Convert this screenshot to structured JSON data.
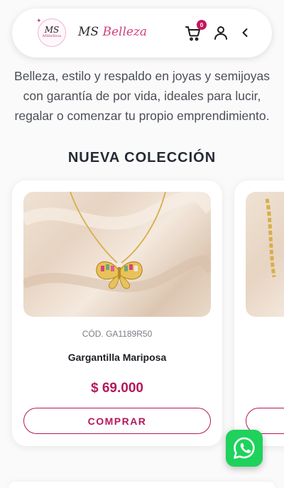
{
  "header": {
    "logo_monogram": "MS",
    "logo_subtext": "MSbelleza",
    "brand_ms": "MS",
    "brand_belleza": "Belleza",
    "cart_count": "0",
    "cart_icon": "cart-icon",
    "user_icon": "user-icon",
    "back_icon": "chevron-left-icon"
  },
  "intro": {
    "text": "Belleza, estilo y respaldo en joyas y semijoyas con garantía de por vida, ideales para lucir, regalar o comenzar tu propio emprendimiento."
  },
  "section": {
    "title": "NUEVA COLECCIÓN"
  },
  "products": [
    {
      "code": "CÓD. GA1189R50",
      "name": "Gargantilla Mariposa",
      "price": "$ 69.000",
      "button": "COMPRAR"
    }
  ],
  "colors": {
    "accent": "#b4185c",
    "brand_pink": "#d1427f",
    "whatsapp": "#1ed25c"
  }
}
